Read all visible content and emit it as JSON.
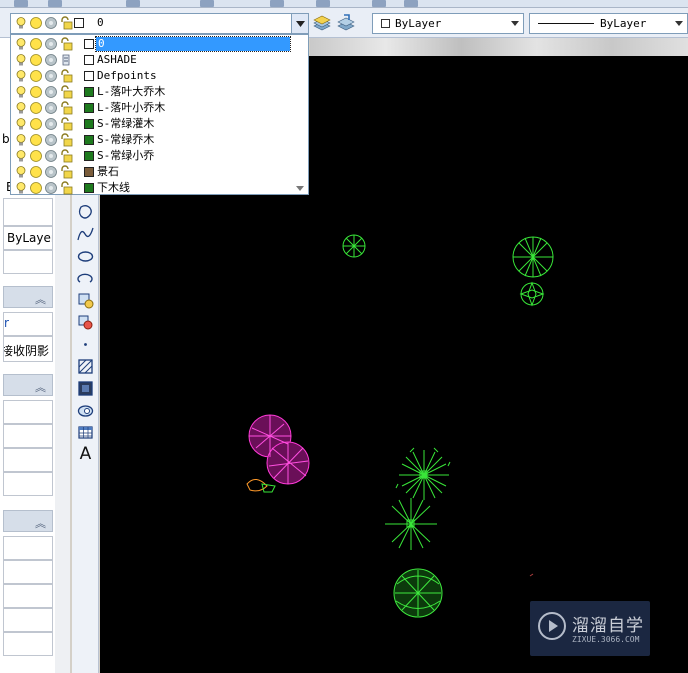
{
  "layer_control": {
    "current_layer": "0",
    "icons": [
      "lightbulb-icon",
      "sun-icon",
      "freeze-icon",
      "lock-icon"
    ]
  },
  "layers": [
    {
      "name": "0",
      "color": "#ffffff",
      "selected": true
    },
    {
      "name": "ASHADE",
      "color": "#ffffff",
      "selected": false
    },
    {
      "name": "Defpoints",
      "color": "#ffffff",
      "selected": false
    },
    {
      "name": "L-落叶大乔木",
      "color": "#1e7a1e",
      "selected": false
    },
    {
      "name": "L-落叶小乔木",
      "color": "#1e7a1e",
      "selected": false
    },
    {
      "name": "S-常绿灌木",
      "color": "#1e7a1e",
      "selected": false
    },
    {
      "name": "S-常绿乔木",
      "color": "#1e7a1e",
      "selected": false
    },
    {
      "name": "S-常绿小乔",
      "color": "#1e7a1e",
      "selected": false
    },
    {
      "name": "景石",
      "color": "#7a5c3a",
      "selected": false
    },
    {
      "name": "下木线",
      "color": "#1e7a1e",
      "selected": false
    }
  ],
  "properties": {
    "color_value": "ByLayer",
    "linetype_value": "ByLayer"
  },
  "left_panel": {
    "row_text_1": "by",
    "row_text_2": "E",
    "bylayer": "ByLayer",
    "shadow_text": "接收阴影",
    "row_text_r": "r"
  },
  "draw_tools": [
    "region-icon",
    "spline-icon",
    "ellipse-icon",
    "ellipse-arc-icon",
    "insert-block-icon",
    "make-block-icon",
    "point-icon",
    "hatch-icon",
    "gradient-icon",
    "boundary-icon",
    "table-icon",
    "text-icon"
  ],
  "draw_text_tool": "A",
  "watermark": {
    "title": "溜溜自学",
    "subtitle": "ZIXUE.3066.COM"
  }
}
